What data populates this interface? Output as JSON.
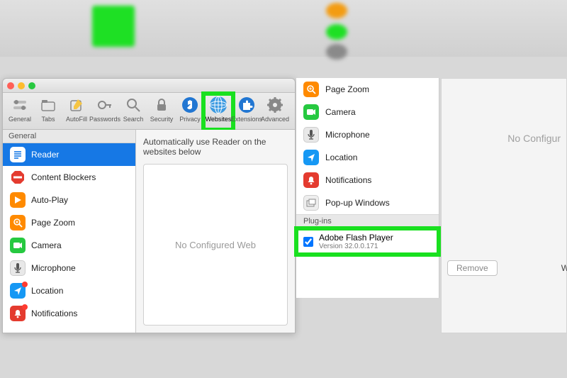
{
  "toolbar": [
    {
      "id": "general",
      "label": "General",
      "icon": "switches"
    },
    {
      "id": "tabs",
      "label": "Tabs",
      "icon": "tabs"
    },
    {
      "id": "autofill",
      "label": "AutoFill",
      "icon": "pencil"
    },
    {
      "id": "passwords",
      "label": "Passwords",
      "icon": "key"
    },
    {
      "id": "search",
      "label": "Search",
      "icon": "magnifier"
    },
    {
      "id": "security",
      "label": "Security",
      "icon": "lock"
    },
    {
      "id": "privacy",
      "label": "Privacy",
      "icon": "hand"
    },
    {
      "id": "websites",
      "label": "Websites",
      "icon": "globe",
      "selected": true,
      "highlight": true
    },
    {
      "id": "extensions",
      "label": "Extensions",
      "icon": "puzzle"
    },
    {
      "id": "advanced",
      "label": "Advanced",
      "icon": "gear"
    }
  ],
  "sidebar": {
    "section": "General",
    "items": [
      {
        "label": "Reader",
        "icon": "reader",
        "selected": true
      },
      {
        "label": "Content Blockers",
        "icon": "blocker"
      },
      {
        "label": "Auto-Play",
        "icon": "play"
      },
      {
        "label": "Page Zoom",
        "icon": "zoom"
      },
      {
        "label": "Camera",
        "icon": "camera"
      },
      {
        "label": "Microphone",
        "icon": "mic"
      },
      {
        "label": "Location",
        "icon": "location",
        "dot": true
      },
      {
        "label": "Notifications",
        "icon": "bell",
        "dot": true
      }
    ]
  },
  "content": {
    "hint": "Automatically use Reader on the websites below",
    "empty": "No Configured Web"
  },
  "panel2": {
    "items": [
      {
        "label": "Page Zoom",
        "icon": "zoom"
      },
      {
        "label": "Camera",
        "icon": "camera"
      },
      {
        "label": "Microphone",
        "icon": "mic"
      },
      {
        "label": "Location",
        "icon": "location",
        "dot": true
      },
      {
        "label": "Notifications",
        "icon": "bell",
        "dot": true
      },
      {
        "label": "Pop-up Windows",
        "icon": "popup"
      }
    ],
    "plugins_section": "Plug-ins",
    "flash": {
      "label": "Adobe Flash Player",
      "version": "Version 32.0.0.171",
      "checked": true
    }
  },
  "right": {
    "empty": "No Configur",
    "remove": "Remove",
    "when": "W"
  }
}
